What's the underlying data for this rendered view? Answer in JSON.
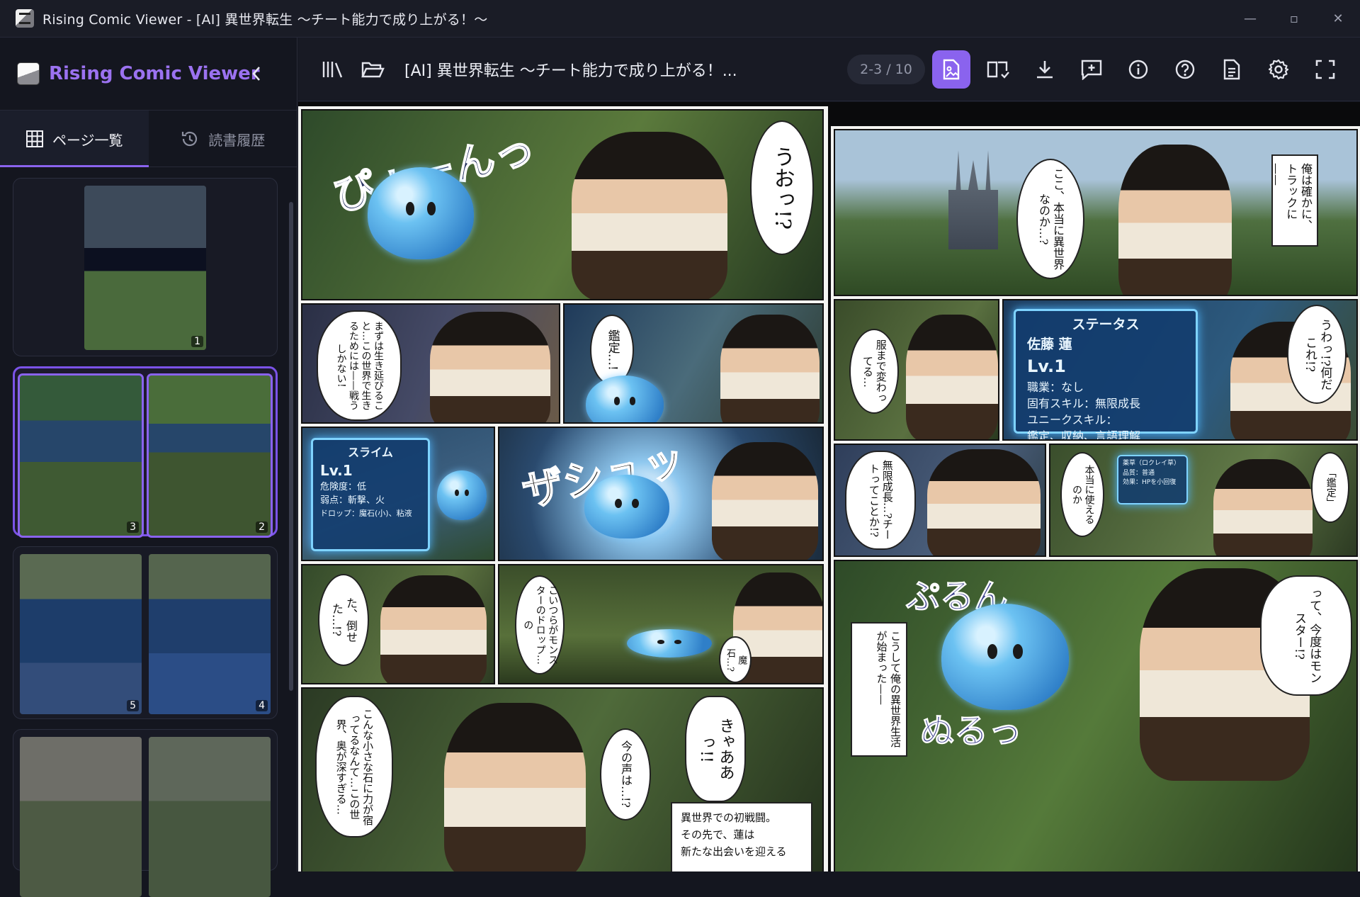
{
  "window": {
    "title": "Rising Comic Viewer - [AI] 異世界転生 ～チート能力で成り上がる！～",
    "controls": {
      "minimize": "—",
      "maximize": "▫",
      "close": "✕"
    }
  },
  "sidebar": {
    "brand": "Rising Comic Viewer",
    "tabs": [
      {
        "label": "ページ一覧",
        "icon": "grid-icon",
        "active": true
      },
      {
        "label": "読書履歴",
        "icon": "history-icon",
        "active": false
      }
    ],
    "thumbnails": [
      {
        "pages": [
          "1"
        ],
        "selected": false
      },
      {
        "pages": [
          "3",
          "2"
        ],
        "selected": true
      },
      {
        "pages": [
          "5",
          "4"
        ],
        "selected": false
      },
      {
        "pages": [
          "",
          ""
        ],
        "selected": false
      }
    ]
  },
  "toolbar": {
    "book_title": "[AI] 異世界転生 ～チート能力で成り上がる！...",
    "page_counter": "2-3 / 10",
    "accent": "#8a63ee"
  },
  "page_left": {
    "p1_sfx": "ぴょーんっ",
    "p1_bubble": "うおっ!?",
    "p2_bubble": "まずは生き延びること…この世界で生きるためには——戦うしかない!",
    "p3_bubble": "鑑定…!",
    "status": {
      "title": "スライム",
      "level": "Lv.1",
      "lines": [
        "危険度：低",
        "弱点：斬撃、火",
        "ドロップ：魔石(小)、粘液"
      ]
    },
    "p5_sfx": "ザシュッ",
    "p6_bubble": "た、倒せた…!?",
    "p7_bubble": "こいつらがモンスターのドロップ…の",
    "p7_small": "魔石…?",
    "p8_bubble_a": "こんな小さな石に力が宿ってるなんて…この世界、奥が深すぎる…",
    "p8_bubble_b": "今の声は…!?",
    "p8_bubble_c": "きゃああっ!!",
    "narration": [
      "異世界での初戦闘。",
      "その先で、蓮は",
      "新たな出会いを迎える"
    ]
  },
  "page_right": {
    "q1_box": "俺は確かに、トラックに——",
    "q1_bubble": "ここ、本当に異世界なのか…?",
    "q2_bubble": "服まで変わってる…",
    "status": {
      "title": "ステータス",
      "name": "佐藤 蓮",
      "level": "Lv.1",
      "lines": [
        "職業：なし",
        "固有スキル：無限成長",
        "ユニークスキル：",
        "鑑定、収納、言語理解"
      ]
    },
    "q3_bubble": "うわっ!?何だこれ!?",
    "q4_bubble": "無限成長…?チートってことか!?",
    "q5_bubble": "本当に使えるのか",
    "q5_item": {
      "name": "薬草（ロクレイ草）",
      "quality": "品質：普通",
      "effect": "効果：HPを小回復"
    },
    "q5_bubble_b": "「鑑定」",
    "q6_sfx_a": "ぷるん",
    "q6_sfx_b": "ぬるっ",
    "q6_box": "こうして俺の異世界生活が始まった——",
    "q6_bubble": "って、今度はモンスター!?"
  }
}
